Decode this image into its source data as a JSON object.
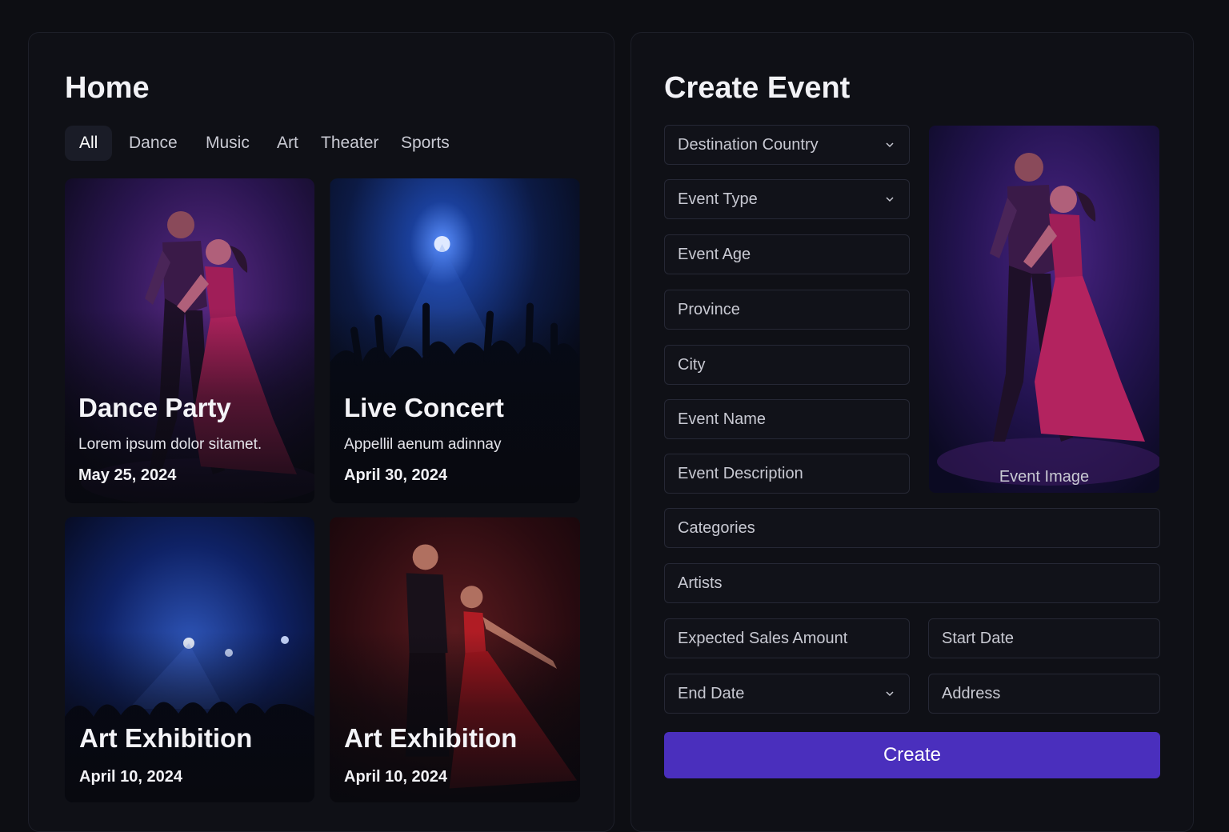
{
  "home": {
    "title": "Home",
    "tabs": [
      "All",
      "Dance",
      "Music",
      "Art",
      "Theater",
      "Sports"
    ],
    "active_tab": "All",
    "cards": [
      {
        "title": "Dance Party",
        "description": "Lorem ipsum dolor sitamet.",
        "date": "May 25, 2024",
        "image": "dancing-couple-purple"
      },
      {
        "title": "Live Concert",
        "description": "Appellil aenum adinnay",
        "date": "April 30, 2024",
        "image": "concert-crowd-blue"
      },
      {
        "title": "Art Exhibition",
        "description": "",
        "date": "April 10, 2024",
        "image": "stage-lights-crowd-blue"
      },
      {
        "title": "Art Exhibition",
        "description": "",
        "date": "April 10, 2024",
        "image": "dancing-couple-red"
      }
    ]
  },
  "create": {
    "title": "Create Event",
    "destination_country": "Destination Country",
    "event_type": "Event Type",
    "event_age": "Event Age",
    "province": "Province",
    "city": "City",
    "event_name": "Event Name",
    "event_description": "Event Description",
    "categories": "Categories",
    "artists": "Artists",
    "expected_sales": "Expected Sales Amount",
    "start_date": "Start Date",
    "end_date": "End Date",
    "address": "Address",
    "image_label": "Event Image",
    "button": "Create"
  },
  "colors": {
    "background": "#0d0e13",
    "panel": "#0f1016",
    "accent": "#4a2fbd"
  }
}
